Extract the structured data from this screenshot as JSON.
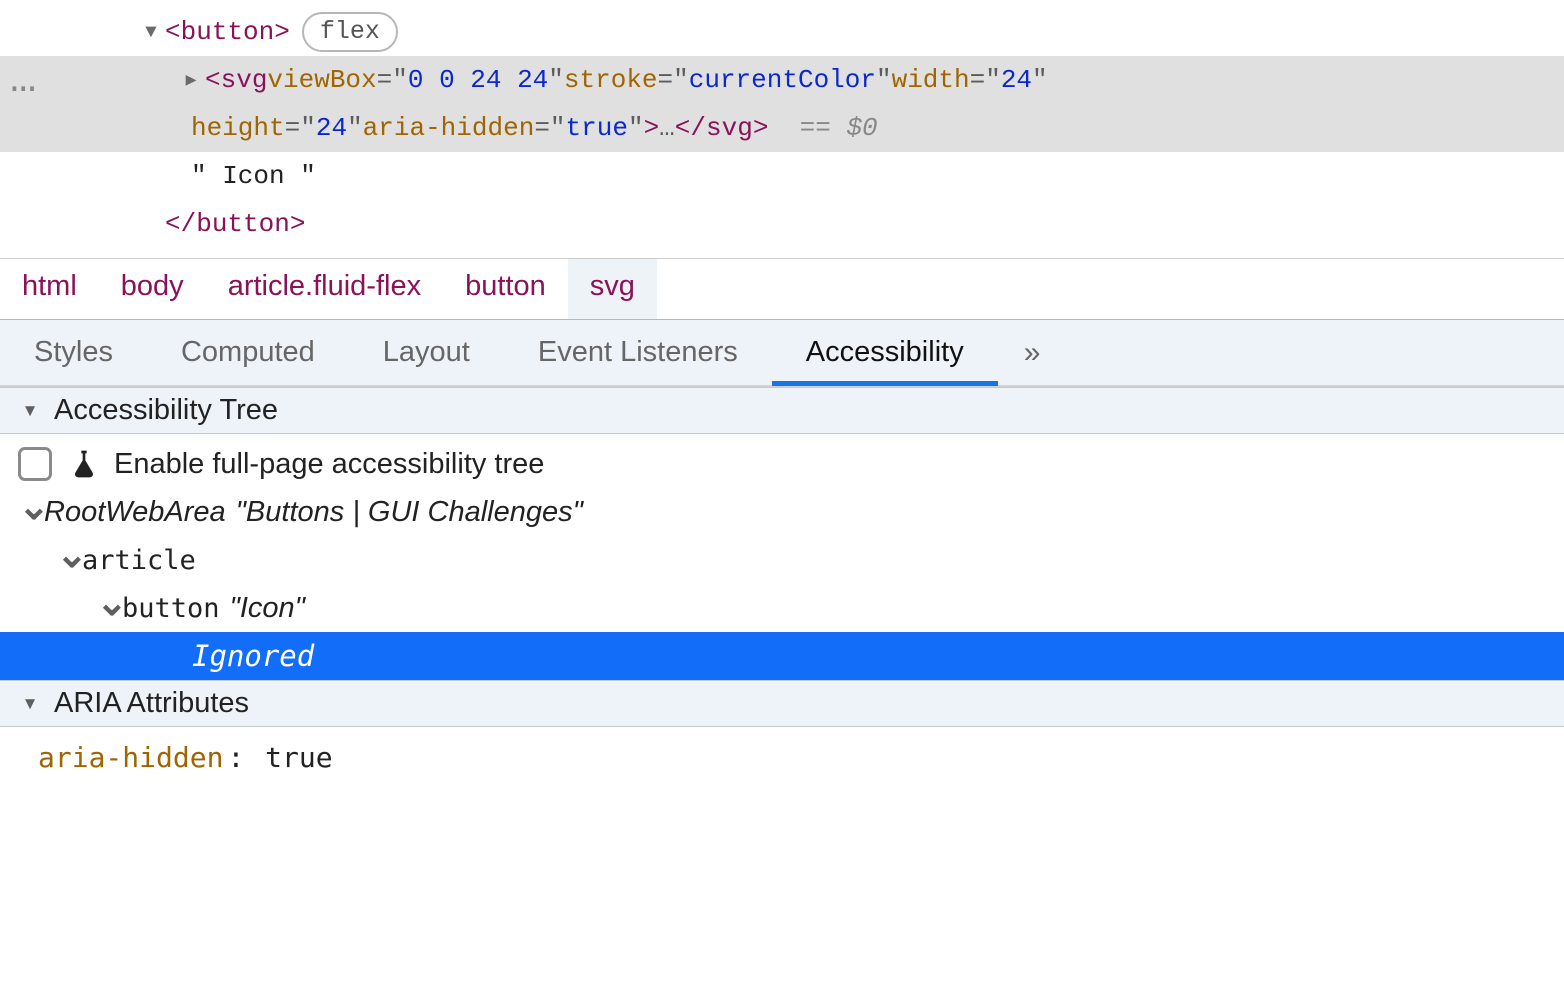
{
  "dom": {
    "button_open": "button",
    "flex_badge": "flex",
    "svg_tag": "svg",
    "svg_attrs": [
      {
        "name": "viewBox",
        "value": "0 0 24 24"
      },
      {
        "name": "stroke",
        "value": "currentColor"
      },
      {
        "name": "width",
        "value": "24"
      },
      {
        "name": "height",
        "value": "24"
      },
      {
        "name": "aria-hidden",
        "value": "true"
      }
    ],
    "svg_ellipsis": "…",
    "svg_close": "svg",
    "dollar_ref": "== $0",
    "text_node": "\" Icon \"",
    "button_close": "button"
  },
  "breadcrumb": [
    "html",
    "body",
    "article.fluid-flex",
    "button",
    "svg"
  ],
  "tabs": {
    "items": [
      "Styles",
      "Computed",
      "Layout",
      "Event Listeners",
      "Accessibility"
    ],
    "active_index": 4,
    "overflow": "»"
  },
  "acc_tree": {
    "header": "Accessibility Tree",
    "enable_label": "Enable full-page accessibility tree",
    "nodes": {
      "root_role": "RootWebArea",
      "root_name": "\"Buttons | GUI Challenges\"",
      "article_role": "article",
      "button_role": "button",
      "button_name": "\"Icon\"",
      "ignored": "Ignored"
    }
  },
  "aria_section": {
    "header": "ARIA Attributes",
    "attr_name": "aria-hidden",
    "attr_value": "true"
  }
}
